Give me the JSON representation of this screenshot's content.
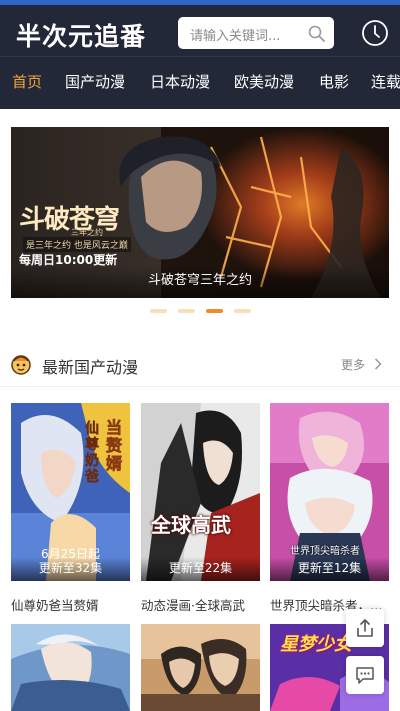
{
  "header": {
    "logo": "半次元追番",
    "search_placeholder": "请输入关键词...",
    "history_icon": "clock-icon",
    "search_icon": "search-icon"
  },
  "nav": {
    "items": [
      {
        "label": "首页",
        "active": true
      },
      {
        "label": "国产动漫",
        "active": false
      },
      {
        "label": "日本动漫",
        "active": false
      },
      {
        "label": "欧美动漫",
        "active": false
      },
      {
        "label": "电影",
        "active": false
      },
      {
        "label": "连载",
        "active": false
      }
    ]
  },
  "banner": {
    "caption": "斗破苍穹三年之约",
    "art_title": "斗破苍穹",
    "art_subtitle": "三年之约",
    "art_tagline": "是三年之约 也是风云之巅",
    "art_schedule": "每周日10:00更新",
    "slide_count": 4,
    "active_slide": 3
  },
  "section": {
    "title": "最新国产动漫",
    "more_label": "更多",
    "icon": "mascot-icon",
    "colors": {
      "accent": "#f28a28",
      "nav_active": "#f4a43a",
      "header_bg": "#232838"
    }
  },
  "cards": [
    {
      "title": "仙尊奶爸当赘婿",
      "badge": "更新至32集",
      "poster_text": "6月25日起"
    },
    {
      "title": "动态漫画·全球高武",
      "badge": "更新至22集",
      "poster_text": "全球高武"
    },
    {
      "title": "世界顶尖暗杀者，转生为异世界贵族",
      "badge": "更新至12集",
      "poster_text": "世界顶尖暗杀者"
    },
    {
      "title": "",
      "badge": "",
      "poster_text": ""
    },
    {
      "title": "",
      "badge": "",
      "poster_text": ""
    },
    {
      "title": "",
      "badge": "",
      "poster_text": "星梦少女"
    }
  ],
  "floating": {
    "share_icon": "share-icon",
    "message_icon": "chat-icon"
  }
}
